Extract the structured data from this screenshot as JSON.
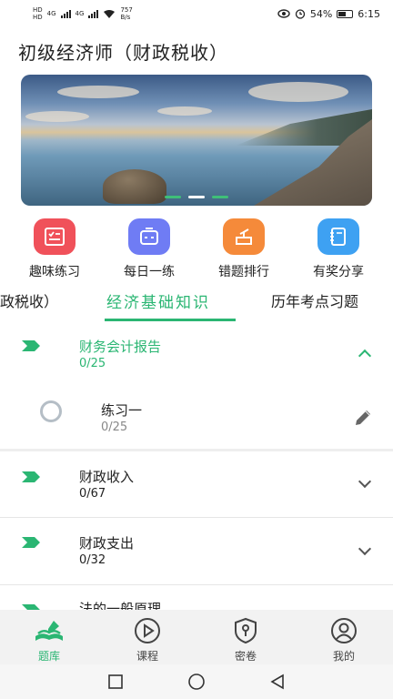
{
  "status_bar": {
    "left_badges": [
      "HD",
      "HD"
    ],
    "network": [
      "4G",
      "4G"
    ],
    "speed_value": "757",
    "speed_unit": "B/s",
    "battery": "54%",
    "time": "6:15"
  },
  "page": {
    "title": "初级经济师（财政税收）"
  },
  "banner": {
    "slides": 3,
    "active_slide": 1
  },
  "quick_menu": [
    {
      "label": "趣味练习",
      "icon": "checklist-icon",
      "color": "#f0515a"
    },
    {
      "label": "每日一练",
      "icon": "robot-icon",
      "color": "#6f7cf4"
    },
    {
      "label": "错题排行",
      "icon": "trophy-icon",
      "color": "#f58a3a"
    },
    {
      "label": "有奖分享",
      "icon": "notebook-icon",
      "color": "#3ea1f2"
    }
  ],
  "tabs": [
    {
      "label": "政税收）",
      "active": false
    },
    {
      "label": "经济基础知识",
      "active": true
    },
    {
      "label": "历年考点习题",
      "active": false
    }
  ],
  "chapters": [
    {
      "title": "财务会计报告",
      "count": "0/25",
      "expanded": true,
      "exercises": [
        {
          "title": "练习一",
          "count": "0/25"
        }
      ]
    },
    {
      "title": "财政收入",
      "count": "0/67",
      "expanded": false
    },
    {
      "title": "财政支出",
      "count": "0/32",
      "expanded": false
    },
    {
      "title": "法的一般原理",
      "count": "",
      "expanded": false
    }
  ],
  "bottom_nav": [
    {
      "label": "题库",
      "icon": "book-icon",
      "active": true
    },
    {
      "label": "课程",
      "icon": "play-icon",
      "active": false
    },
    {
      "label": "密卷",
      "icon": "shield-lock-icon",
      "active": false
    },
    {
      "label": "我的",
      "icon": "user-icon",
      "active": false
    }
  ],
  "colors": {
    "accent": "#2bb673",
    "text": "#222222"
  }
}
